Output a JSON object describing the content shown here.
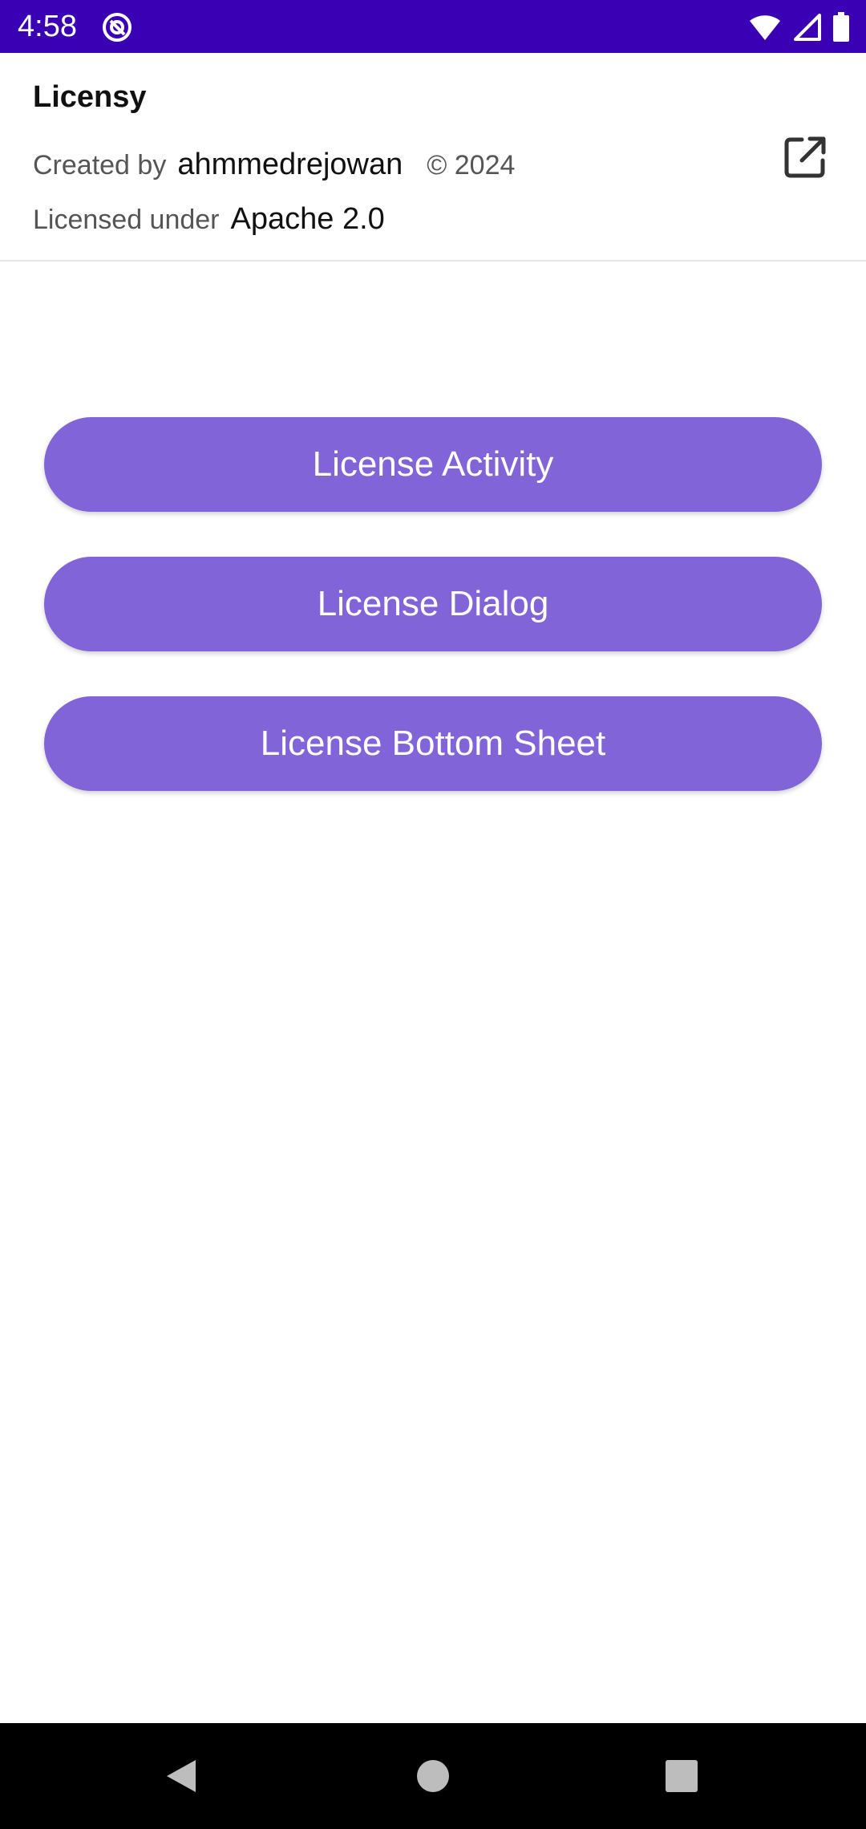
{
  "status_bar": {
    "time": "4:58",
    "background_color": "#3a00b3",
    "app_icon": "at-sign-icon",
    "icons": [
      "wifi-icon",
      "signal-icon",
      "battery-icon"
    ]
  },
  "header": {
    "title": "Licensy",
    "created_by_label": "Created by",
    "author": "ahmmedrejowan",
    "copyright": "© 2024",
    "licensed_under_label": "Licensed under",
    "license": "Apache 2.0",
    "action_icon": "open-in-new-icon"
  },
  "buttons": {
    "activity": "License Activity",
    "dialog": "License Dialog",
    "bottom_sheet": "License Bottom Sheet",
    "color": "#8164d7"
  },
  "nav_bar": {
    "icons": [
      "back-icon",
      "home-icon",
      "recents-icon"
    ]
  }
}
